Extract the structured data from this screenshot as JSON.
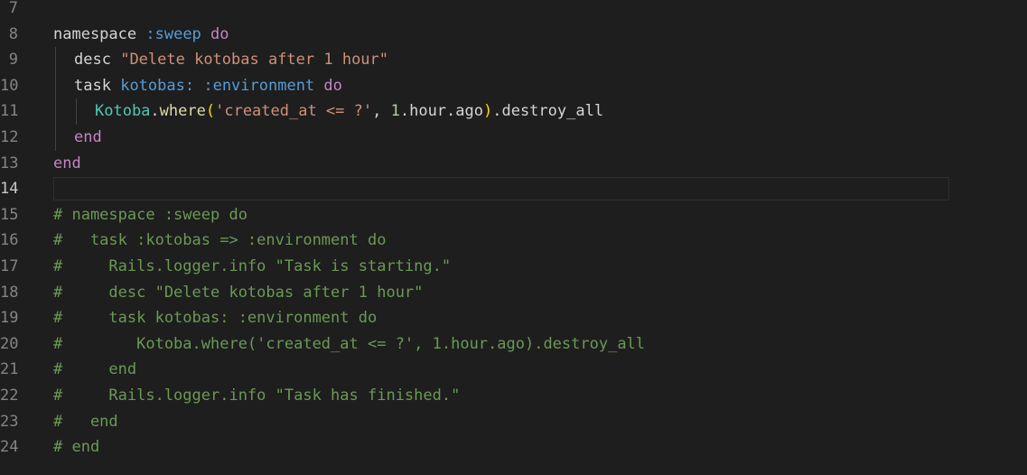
{
  "editor": {
    "first_line": 7,
    "cursor_line": 14,
    "lines": [
      {
        "number": "7",
        "indent": 0,
        "tokens": []
      },
      {
        "number": "8",
        "indent": 0,
        "tokens": [
          {
            "t": "namespace",
            "c": "plain"
          },
          {
            "t": " ",
            "c": "ws"
          },
          {
            "t": ":sweep",
            "c": "sym"
          },
          {
            "t": " ",
            "c": "ws"
          },
          {
            "t": "do",
            "c": "kw"
          }
        ]
      },
      {
        "number": "9",
        "indent": 1,
        "tokens": [
          {
            "t": "desc",
            "c": "plain"
          },
          {
            "t": " ",
            "c": "ws"
          },
          {
            "t": "\"Delete kotobas after 1 hour\"",
            "c": "str"
          }
        ]
      },
      {
        "number": "10",
        "indent": 1,
        "tokens": [
          {
            "t": "task",
            "c": "plain"
          },
          {
            "t": " ",
            "c": "ws"
          },
          {
            "t": "kotobas:",
            "c": "sym"
          },
          {
            "t": " ",
            "c": "ws"
          },
          {
            "t": ":environment",
            "c": "sym"
          },
          {
            "t": " ",
            "c": "ws"
          },
          {
            "t": "do",
            "c": "kw"
          }
        ]
      },
      {
        "number": "11",
        "indent": 2,
        "tokens": [
          {
            "t": "Kotoba",
            "c": "const"
          },
          {
            "t": ".",
            "c": "plain"
          },
          {
            "t": "where",
            "c": "fn"
          },
          {
            "t": "(",
            "c": "paren"
          },
          {
            "t": "'created_at <= ?'",
            "c": "str"
          },
          {
            "t": ",",
            "c": "plain"
          },
          {
            "t": " ",
            "c": "ws"
          },
          {
            "t": "1",
            "c": "num"
          },
          {
            "t": ".hour.ago",
            "c": "plain"
          },
          {
            "t": ")",
            "c": "paren"
          },
          {
            "t": ".destroy_all",
            "c": "plain"
          }
        ]
      },
      {
        "number": "12",
        "indent": 1,
        "tokens": [
          {
            "t": "end",
            "c": "kw"
          }
        ]
      },
      {
        "number": "13",
        "indent": 0,
        "tokens": [
          {
            "t": "end",
            "c": "kw"
          }
        ]
      },
      {
        "number": "14",
        "indent": 0,
        "tokens": []
      },
      {
        "number": "15",
        "indent": 0,
        "tokens": [
          {
            "t": "# namespace :sweep do",
            "c": "comment"
          }
        ]
      },
      {
        "number": "16",
        "indent": 0,
        "tokens": [
          {
            "t": "#   task :kotobas => :environment do",
            "c": "comment"
          }
        ]
      },
      {
        "number": "17",
        "indent": 0,
        "tokens": [
          {
            "t": "#     Rails.logger.info \"Task is starting.\"",
            "c": "comment"
          }
        ]
      },
      {
        "number": "18",
        "indent": 0,
        "tokens": [
          {
            "t": "#     desc \"Delete kotobas after 1 hour\"",
            "c": "comment"
          }
        ]
      },
      {
        "number": "19",
        "indent": 0,
        "tokens": [
          {
            "t": "#     task kotobas: :environment do",
            "c": "comment"
          }
        ]
      },
      {
        "number": "20",
        "indent": 0,
        "tokens": [
          {
            "t": "#        Kotoba.where('created_at <= ?', 1.hour.ago).destroy_all",
            "c": "comment"
          }
        ]
      },
      {
        "number": "21",
        "indent": 0,
        "tokens": [
          {
            "t": "#     end",
            "c": "comment"
          }
        ]
      },
      {
        "number": "22",
        "indent": 0,
        "tokens": [
          {
            "t": "#     Rails.logger.info \"Task has finished.\"",
            "c": "comment"
          }
        ]
      },
      {
        "number": "23",
        "indent": 0,
        "tokens": [
          {
            "t": "#   end",
            "c": "comment"
          }
        ]
      },
      {
        "number": "24",
        "indent": 0,
        "tokens": [
          {
            "t": "# end",
            "c": "comment"
          }
        ]
      }
    ]
  },
  "colors": {
    "background": "#1e1e1e",
    "line_number": "#858585",
    "plain": "#d4d4d4",
    "keyword": "#c586c0",
    "symbol": "#569cd6",
    "string": "#ce9178",
    "number": "#b5cea8",
    "constant": "#4ec9b0",
    "function": "#dcdcaa",
    "comment": "#6a9955"
  }
}
